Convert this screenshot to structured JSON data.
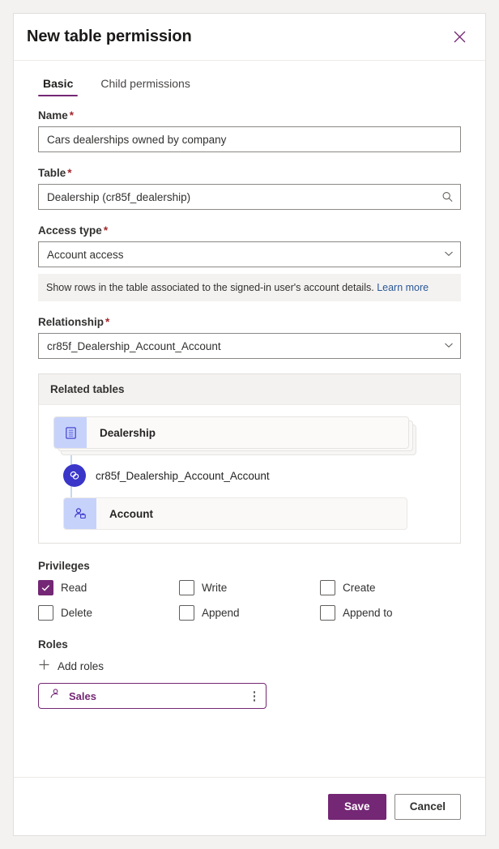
{
  "dialog": {
    "title": "New table permission",
    "close_icon": "close-icon"
  },
  "tabs": [
    {
      "label": "Basic",
      "active": true
    },
    {
      "label": "Child permissions",
      "active": false
    }
  ],
  "form": {
    "name": {
      "label": "Name",
      "required_marker": "*",
      "value": "Cars dealerships owned by company"
    },
    "table": {
      "label": "Table",
      "required_marker": "*",
      "value": "Dealership (cr85f_dealership)",
      "icon": "search-icon"
    },
    "access_type": {
      "label": "Access type",
      "required_marker": "*",
      "value": "Account access",
      "icon": "chevron-down-icon",
      "info_text": "Show rows in the table associated to the signed-in user's account details.",
      "info_link": "Learn more"
    },
    "relationship": {
      "label": "Relationship",
      "required_marker": "*",
      "value": "cr85f_Dealership_Account_Account",
      "icon": "chevron-down-icon"
    }
  },
  "related_tables": {
    "header": "Related tables",
    "source_node": {
      "label": "Dealership",
      "icon": "table-icon"
    },
    "relationship_node": {
      "label": "cr85f_Dealership_Account_Account",
      "icon": "link-icon"
    },
    "target_node": {
      "label": "Account",
      "icon": "account-icon"
    }
  },
  "privileges": {
    "label": "Privileges",
    "items": [
      {
        "label": "Read",
        "checked": true
      },
      {
        "label": "Write",
        "checked": false
      },
      {
        "label": "Create",
        "checked": false
      },
      {
        "label": "Delete",
        "checked": false
      },
      {
        "label": "Append",
        "checked": false
      },
      {
        "label": "Append to",
        "checked": false
      }
    ]
  },
  "roles": {
    "label": "Roles",
    "add_label": "Add roles",
    "add_icon": "plus-icon",
    "items": [
      {
        "name": "Sales",
        "icon": "person-icon",
        "menu_icon": "more-vertical-icon"
      }
    ]
  },
  "footer": {
    "save_label": "Save",
    "cancel_label": "Cancel"
  },
  "colors": {
    "accent": "#742774",
    "required": "#a4262c",
    "link": "#2b5797",
    "node_icon_bg": "#c7d2fb",
    "relationship_circle": "#3a36c9"
  }
}
